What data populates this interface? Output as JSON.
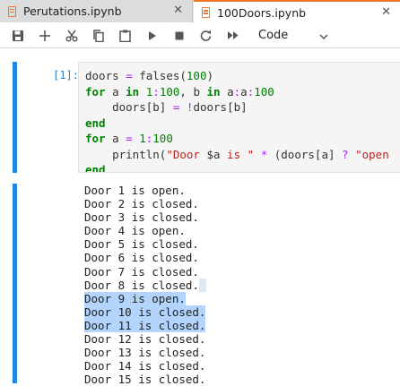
{
  "tabs": [
    {
      "label": "Perutations.ipynb",
      "active": false
    },
    {
      "label": "100Doors.ipynb",
      "active": true
    }
  ],
  "toolbar": {
    "icons": [
      "save-icon",
      "add-cell-icon",
      "cut-icon",
      "copy-icon",
      "paste-icon",
      "run-icon",
      "stop-icon",
      "restart-icon",
      "run-all-icon"
    ],
    "cell_type": "Code"
  },
  "cell": {
    "prompt": "[1]:",
    "code_lines": [
      "doors = falses(100)",
      "for a in 1:100, b in a:a:100",
      "    doors[b] = !doors[b]",
      "end",
      "for a = 1:100",
      "    println(\"Door $a is \" * (doors[a] ? \"open",
      "end"
    ]
  },
  "output": {
    "lines": [
      "Door 1 is open.",
      "Door 2 is closed.",
      "Door 3 is closed.",
      "Door 4 is open.",
      "Door 5 is closed.",
      "Door 6 is closed.",
      "Door 7 is closed.",
      "Door 8 is closed.",
      "Door 9 is open.",
      "Door 10 is closed.",
      "Door 11 is closed.",
      "Door 12 is closed.",
      "Door 13 is closed.",
      "Door 14 is closed.",
      "Door 15 is closed."
    ],
    "selected_lines": [
      8,
      9,
      10
    ]
  },
  "colors": {
    "accent": "#f37626",
    "collapser": "#1e88e5",
    "selection": "#b3d4fc"
  }
}
